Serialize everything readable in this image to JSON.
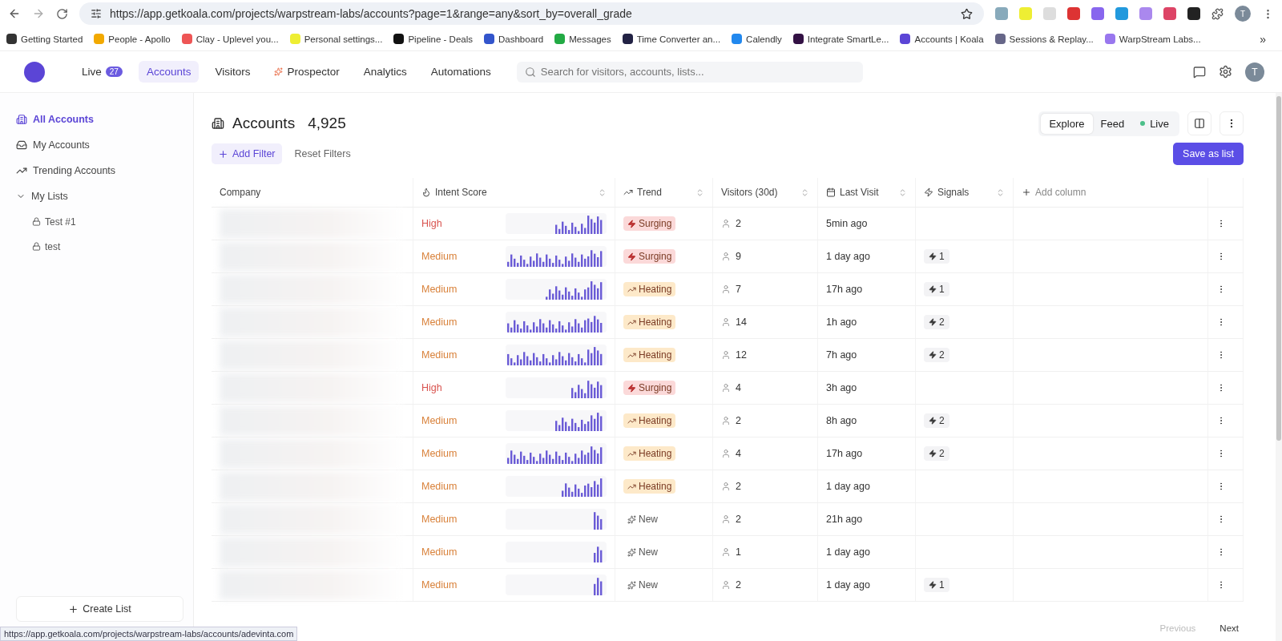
{
  "browser": {
    "url": "https://app.getkoala.com/projects/warpstream-labs/accounts?page=1&range=any&sort_by=overall_grade",
    "profile": "T",
    "bookmarks": [
      "Getting Started",
      "People - Apollo",
      "Clay - Uplevel you...",
      "Personal settings...",
      "Pipeline - Deals",
      "Dashboard",
      "Messages",
      "Time Converter an...",
      "Calendly",
      "Integrate SmartLe...",
      "Accounts | Koala",
      "Sessions & Replay...",
      "WarpStream Labs..."
    ],
    "more": "»"
  },
  "nav": {
    "items": [
      {
        "label": "Live",
        "badge": "27",
        "selected": false
      },
      {
        "label": "Accounts",
        "selected": true
      },
      {
        "label": "Visitors",
        "selected": false
      },
      {
        "label": "Prospector",
        "selected": false
      },
      {
        "label": "Analytics",
        "selected": false
      },
      {
        "label": "Automations",
        "selected": false
      }
    ],
    "search": {
      "placeholder": "Search for visitors, accounts, lists..."
    },
    "avatar": "T"
  },
  "sidebar": {
    "items": [
      {
        "label": "All Accounts",
        "selected": true
      },
      {
        "label": "My Accounts",
        "selected": false
      },
      {
        "label": "Trending Accounts",
        "selected": false
      }
    ],
    "lists": {
      "label": "My Lists",
      "expanded": true,
      "children": [
        {
          "label": "Test #1"
        },
        {
          "label": "test"
        }
      ]
    },
    "create": "Create List"
  },
  "header": {
    "title": "Accounts",
    "count": "4,925",
    "views": [
      {
        "label": "Explore",
        "selected": true
      },
      {
        "label": "Feed",
        "selected": false
      },
      {
        "label": "Live",
        "selected": false
      }
    ],
    "add_filter": "Add Filter",
    "reset": "Reset Filters",
    "save": "Save as list"
  },
  "table": {
    "columns": [
      "Company",
      "Intent Score",
      "Trend",
      "Visitors (30d)",
      "Last Visit",
      "Signals",
      "Add column"
    ],
    "rows": [
      {
        "intent": {
          "kind": "high",
          "label": "High"
        },
        "trend": {
          "kind": "surging",
          "label": "Surging"
        },
        "visitors": "2",
        "last": "5min ago"
      },
      {
        "intent": "Medium",
        "trend": {
          "kind": "surging",
          "label": "Surging"
        },
        "visitors": "9",
        "last": "1 day ago",
        "signals": "1"
      },
      {
        "intent": "Medium",
        "trend": {
          "kind": "heating",
          "label": "Heating"
        },
        "visitors": "7",
        "last": "17h ago",
        "signals": "1"
      },
      {
        "intent": "Medium",
        "trend": {
          "kind": "heating",
          "label": "Heating"
        },
        "visitors": "14",
        "last": "1h ago",
        "signals": "2"
      },
      {
        "intent": "Medium",
        "trend": {
          "kind": "heating",
          "label": "Heating"
        },
        "visitors": "12",
        "last": "7h ago",
        "signals": "2"
      },
      {
        "intent": {
          "kind": "high",
          "label": "High"
        },
        "trend": {
          "kind": "surging",
          "label": "Surging"
        },
        "visitors": "4",
        "last": "3h ago"
      },
      {
        "intent": "Medium",
        "trend": {
          "kind": "heating",
          "label": "Heating"
        },
        "visitors": "2",
        "last": "8h ago",
        "signals": "2"
      },
      {
        "intent": "Medium",
        "trend": {
          "kind": "heating",
          "label": "Heating"
        },
        "visitors": "4",
        "last": "17h ago",
        "signals": "2"
      },
      {
        "intent": "Medium",
        "trend": {
          "kind": "heating",
          "label": "Heating"
        },
        "visitors": "2",
        "last": "1 day ago"
      },
      {
        "intent": "Medium",
        "trend": {
          "kind": "new",
          "label": "New"
        },
        "visitors": "2",
        "last": "21h ago"
      },
      {
        "intent": "Medium",
        "trend": {
          "kind": "new",
          "label": "New"
        },
        "visitors": "1",
        "last": "1 day ago"
      },
      {
        "intent": "Medium",
        "trend": {
          "kind": "new",
          "label": "New"
        },
        "visitors": "2",
        "last": "1 day ago",
        "signals": "1"
      }
    ]
  },
  "pager": {
    "previous": "Previous",
    "next": "Next"
  },
  "status_url": "https://app.getkoala.com/projects/warpstream-labs/accounts/adevinta.com"
}
